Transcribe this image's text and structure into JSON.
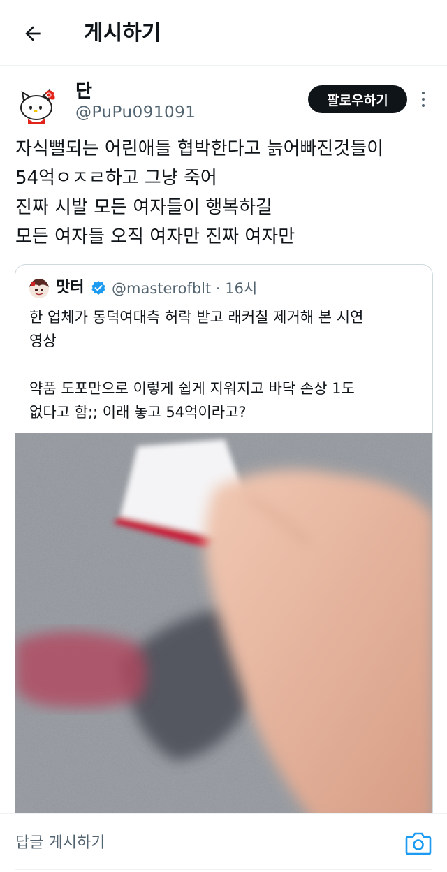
{
  "header": {
    "title": "게시하기",
    "back_icon": "arrow-left-icon"
  },
  "tweet": {
    "author_name": "단",
    "author_handle": "@PuPu091091",
    "follow_label": "팔로우하기",
    "more_icon": "more-vertical-icon",
    "text_lines": [
      "자식뻘되는 어린애들 협박한다고 늙어빠진것들이",
      "54억ㅇㅈㄹ하고 그냥 죽어",
      "진짜 시발 모든 여자들이 행복하길",
      "모든 여자들 오직 여자만 진짜 여자만"
    ]
  },
  "quote": {
    "author_name": "맛터",
    "verified_icon": "verified-badge-icon",
    "handle_time": "@masterofblt · 16시",
    "text_lines": [
      "한 업체가 동덕여대측 허락 받고 래커칠 제거해 본 시연",
      "영상",
      "",
      "약품 도포만으로 이렇게 쉽게 지워지고 바닥 손상 1도",
      "없다고 함;; 이래 놓고 54억이라고?"
    ]
  },
  "reply_bar": {
    "placeholder": "답글 게시하기",
    "camera_icon": "camera-icon"
  },
  "colors": {
    "text_primary": "#0f1419",
    "text_secondary": "#536471",
    "accent": "#1d9bf0",
    "border": "#cfd9de"
  }
}
